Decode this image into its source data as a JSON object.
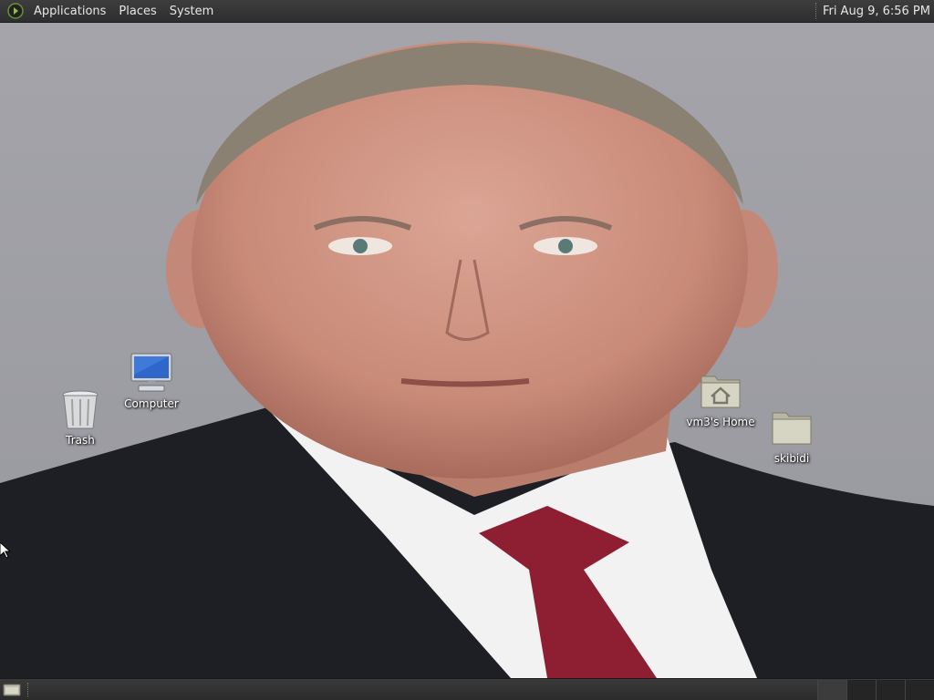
{
  "top_panel": {
    "menus": [
      "Applications",
      "Places",
      "System"
    ],
    "clock": "Fri Aug  9,  6:56 PM"
  },
  "desktop": {
    "icons": {
      "computer": {
        "label": "Computer",
        "icon": "computer-icon"
      },
      "trash": {
        "label": "Trash",
        "icon": "trash-icon"
      },
      "home": {
        "label": "vm3's Home",
        "icon": "home-folder-icon"
      },
      "skibidi": {
        "label": "skibidi",
        "icon": "folder-icon"
      }
    },
    "wallpaper": "portrait photo of a man in a dark suit, white shirt and red tie"
  },
  "bottom_panel": {
    "workspace_count": 4,
    "active_workspace": 1
  },
  "colors": {
    "panel_bg": "#2e2e2e",
    "panel_text": "#e6e6e6",
    "wallpaper_bg": "#9c9ca3",
    "tie": "#8e1f33"
  }
}
